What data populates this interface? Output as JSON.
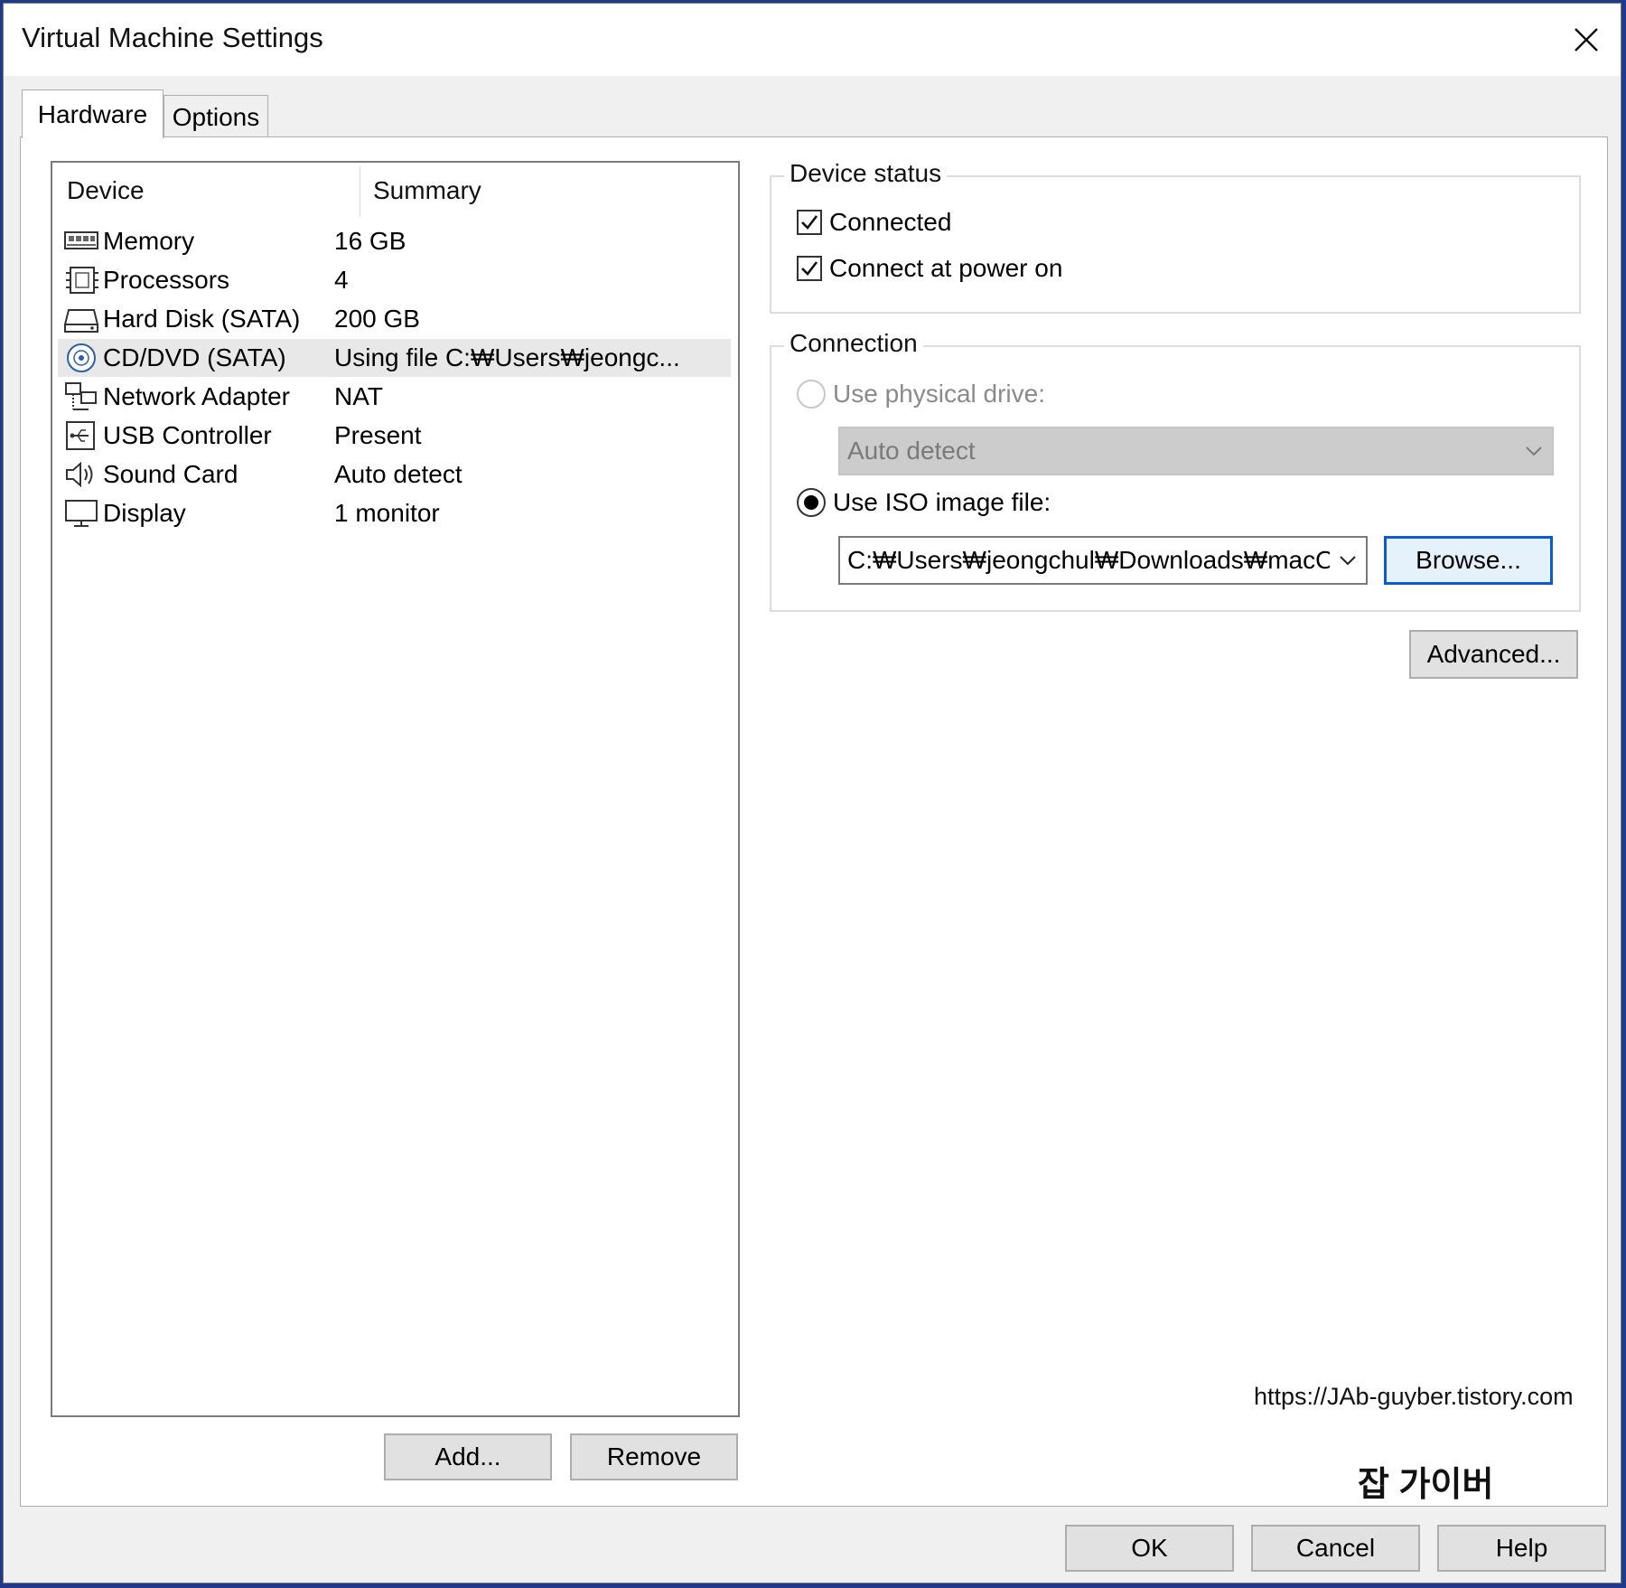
{
  "window": {
    "title": "Virtual Machine Settings"
  },
  "tabs": [
    {
      "label": "Hardware",
      "active": true
    },
    {
      "label": "Options",
      "active": false
    }
  ],
  "device_list": {
    "columns": [
      "Device",
      "Summary"
    ],
    "rows": [
      {
        "name": "Memory",
        "summary": "16 GB",
        "icon": "memory-icon",
        "selected": false
      },
      {
        "name": "Processors",
        "summary": "4",
        "icon": "processor-icon",
        "selected": false
      },
      {
        "name": "Hard Disk (SATA)",
        "summary": "200 GB",
        "icon": "hard-disk-icon",
        "selected": false
      },
      {
        "name": "CD/DVD (SATA)",
        "summary": "Using file C:₩Users₩jeongc...",
        "icon": "cd-dvd-icon",
        "selected": true
      },
      {
        "name": "Network Adapter",
        "summary": "NAT",
        "icon": "network-adapter-icon",
        "selected": false
      },
      {
        "name": "USB Controller",
        "summary": "Present",
        "icon": "usb-controller-icon",
        "selected": false
      },
      {
        "name": "Sound Card",
        "summary": "Auto detect",
        "icon": "sound-card-icon",
        "selected": false
      },
      {
        "name": "Display",
        "summary": "1 monitor",
        "icon": "display-icon",
        "selected": false
      }
    ],
    "add_label": "Add...",
    "remove_label": "Remove"
  },
  "device_status": {
    "title": "Device status",
    "connected_label": "Connected",
    "connected_checked": true,
    "power_on_label": "Connect at power on",
    "power_on_checked": true
  },
  "connection": {
    "title": "Connection",
    "physical_label": "Use physical drive:",
    "physical_selected": false,
    "physical_value": "Auto detect",
    "iso_label": "Use ISO image file:",
    "iso_selected": true,
    "iso_value": "C:₩Users₩jeongchul₩Downloads₩macO",
    "browse_label": "Browse..."
  },
  "advanced_label": "Advanced...",
  "footer": {
    "ok_label": "OK",
    "cancel_label": "Cancel",
    "help_label": "Help"
  },
  "watermark": {
    "title": "잡 가이버",
    "url": "https://JAb-guyber.tistory.com"
  },
  "colors": {
    "focus_border": "#0a5ad1",
    "selected_row": "#e8e8e8",
    "background": "#f0f0f0"
  }
}
